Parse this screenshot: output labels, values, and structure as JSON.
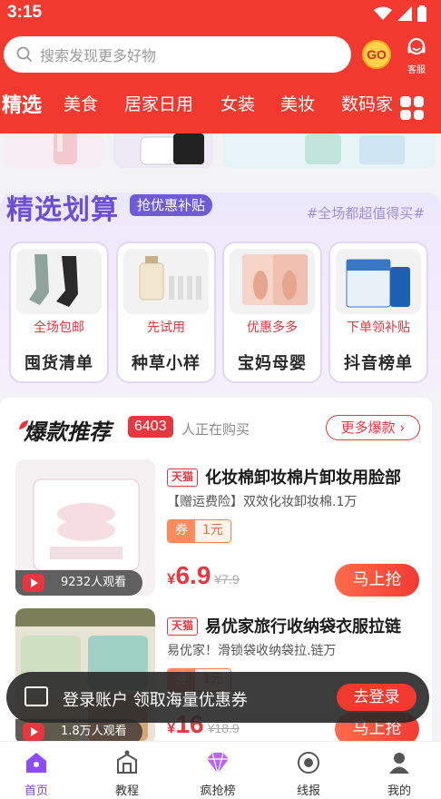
{
  "status_bar": {
    "time": "3:15"
  },
  "search": {
    "placeholder": "搜索发现更多好物"
  },
  "go_button": "GO",
  "service": {
    "label": "客服"
  },
  "tabs": [
    "精选",
    "美食",
    "居家日用",
    "女装",
    "美妆",
    "数码家"
  ],
  "deals": {
    "title": "精选划算",
    "tag": "抢优惠补贴",
    "slogan": "#全场都超值得买#",
    "cards": [
      {
        "badge": "全场包邮",
        "name": "囤货清单"
      },
      {
        "badge": "先试用",
        "name": "种草小样"
      },
      {
        "badge": "优惠多多",
        "name": "宝妈母婴"
      },
      {
        "badge": "下单领补贴",
        "name": "抖音榜单"
      }
    ]
  },
  "hot": {
    "title": "爆款推荐",
    "count": "6403",
    "live_text": "人正在购买",
    "more": "更多爆款 ›",
    "products": [
      {
        "store": "天猫",
        "title": "化妆棉卸妆棉片卸妆用脸部",
        "desc": "【赠运费险】双效化妆卸妆棉.1万",
        "coupon_label": "券",
        "coupon_value": "1元",
        "yen": "¥",
        "price": "6.9",
        "old_price": "¥7.9",
        "viewers": "9232人观看",
        "buy": "马上抢"
      },
      {
        "store": "天猫",
        "title": "易优家旅行收纳袋衣服拉链",
        "desc": "易优家！滑锁袋收纳袋拉.链万",
        "coupon_label": "券",
        "coupon_value": "1元",
        "yen": "¥",
        "price": "16",
        "old_price": "¥18.9",
        "viewers": "1.8万人观看",
        "buy": "马上抢"
      }
    ]
  },
  "toast": {
    "text": "登录账户 领取海量优惠券",
    "button": "去登录"
  },
  "nav": [
    {
      "label": "首页",
      "icon": "home-icon"
    },
    {
      "label": "教程",
      "icon": "tutorial-icon"
    },
    {
      "label": "疯抢榜",
      "icon": "diamond-icon"
    },
    {
      "label": "线报",
      "icon": "radar-icon"
    },
    {
      "label": "我的",
      "icon": "user-icon"
    }
  ],
  "colors": {
    "primary_red": "#f2392f",
    "deal_purple": "#6b4fd6",
    "nav_active": "#7d44f0"
  }
}
